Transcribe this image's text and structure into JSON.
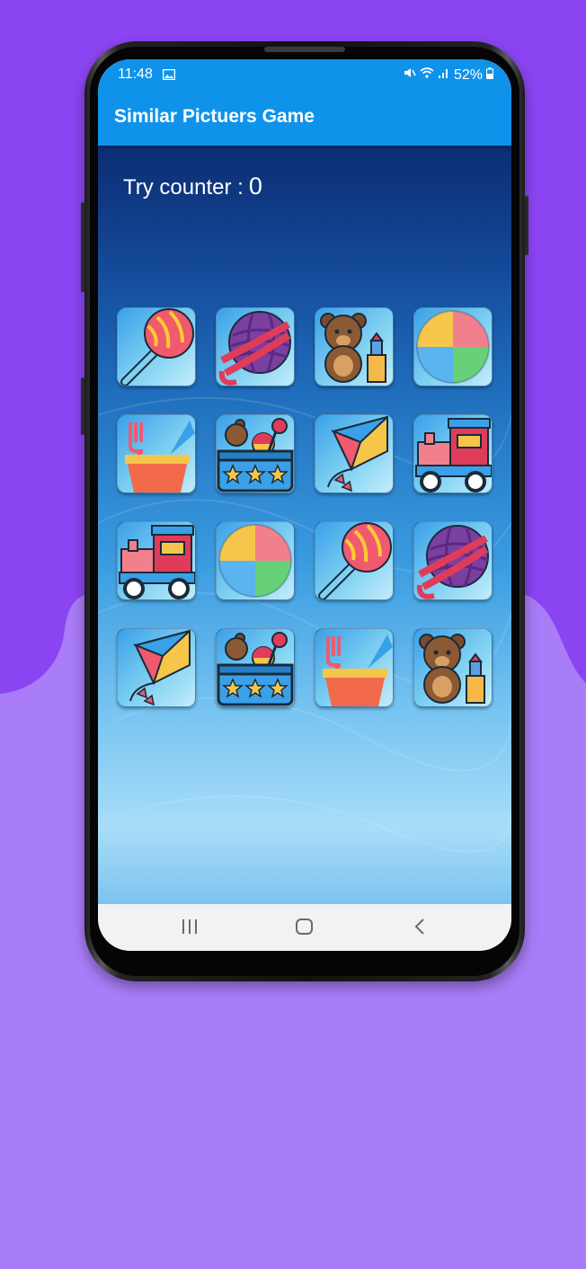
{
  "status_bar": {
    "time": "11:48",
    "battery": "52%",
    "icons": [
      "image-icon",
      "mute-icon",
      "wifi-icon",
      "signal-icon",
      "battery-icon"
    ]
  },
  "app_bar": {
    "title": "Similar Pictuers Game"
  },
  "game": {
    "try_counter_label": "Try counter :",
    "try_counter_value": "0",
    "cards": [
      {
        "icon": "rattle"
      },
      {
        "icon": "yarn-ball"
      },
      {
        "icon": "teddy-bear"
      },
      {
        "icon": "beach-ball"
      },
      {
        "icon": "sand-bucket"
      },
      {
        "icon": "toy-box"
      },
      {
        "icon": "kite"
      },
      {
        "icon": "toy-train"
      },
      {
        "icon": "toy-train"
      },
      {
        "icon": "beach-ball"
      },
      {
        "icon": "rattle"
      },
      {
        "icon": "yarn-ball"
      },
      {
        "icon": "kite"
      },
      {
        "icon": "toy-box"
      },
      {
        "icon": "sand-bucket"
      },
      {
        "icon": "teddy-bear"
      }
    ]
  },
  "nav_bar": {
    "buttons": [
      "recent-apps-icon",
      "home-icon",
      "back-icon"
    ]
  },
  "colors": {
    "background": "#a97cf8",
    "background_top": "#8b44f2",
    "app_bar": "#0f93ea"
  }
}
